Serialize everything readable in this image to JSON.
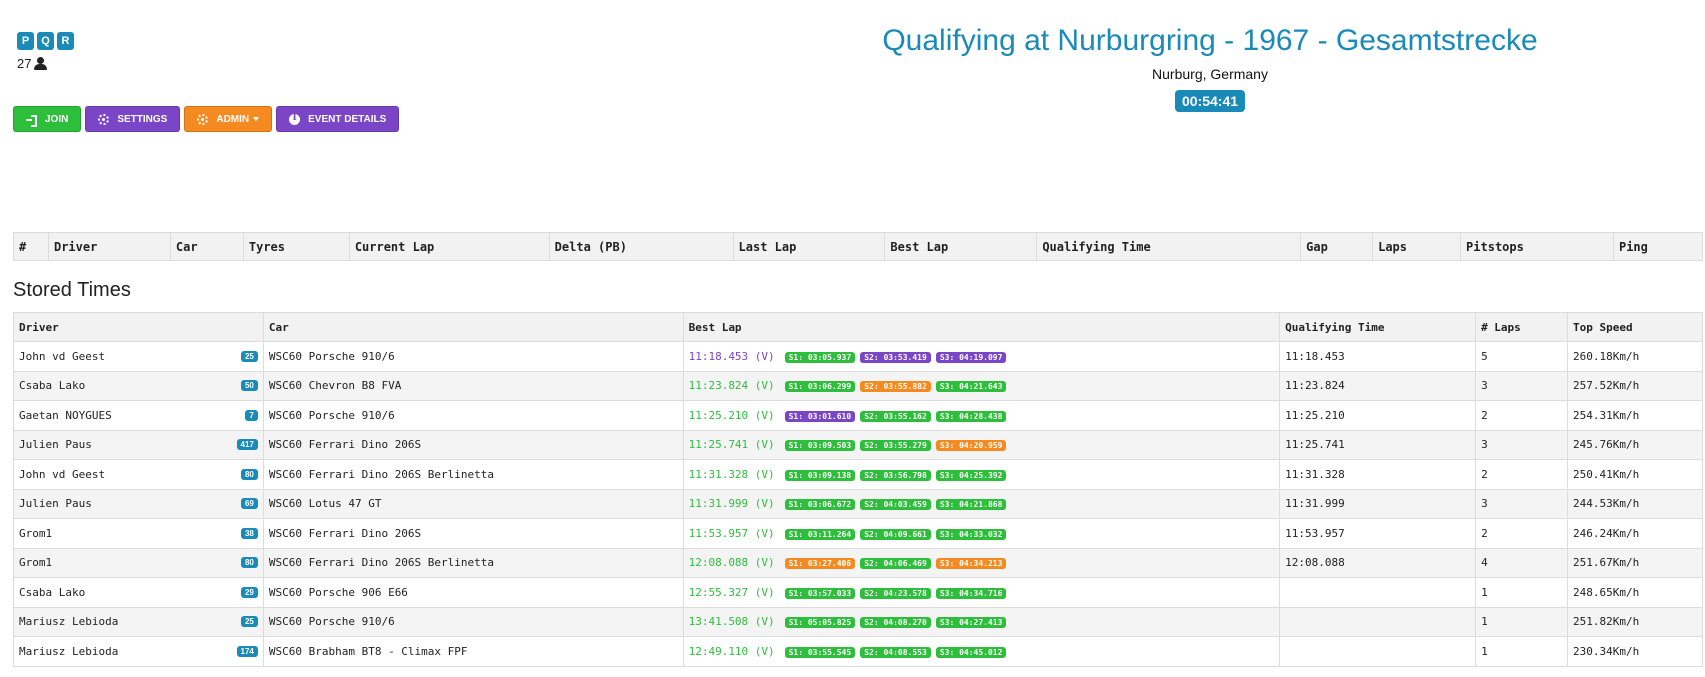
{
  "header": {
    "badges": [
      "P",
      "Q",
      "R"
    ],
    "viewer_count": "27",
    "title": "Qualifying at Nurburgring - 1967 - Gesamtstrecke",
    "location": "Nurburg, Germany",
    "timer": "00:54:41"
  },
  "buttons": {
    "join": "JOIN",
    "settings": "SETTINGS",
    "admin": "ADMIN",
    "event_details": "EVENT DETAILS"
  },
  "colors": {
    "accent": "#1a8ab8",
    "green": "#2dbe3b",
    "purple": "#7a45c6",
    "orange": "#f58a20"
  },
  "live_table": {
    "headers": [
      "#",
      "Driver",
      "Car",
      "Tyres",
      "Current Lap",
      "Delta (PB)",
      "Last Lap",
      "Best Lap",
      "Qualifying Time",
      "Gap",
      "Laps",
      "Pitstops",
      "Ping"
    ]
  },
  "stored": {
    "title": "Stored Times",
    "headers": [
      "Driver",
      "Car",
      "Best Lap",
      "Qualifying Time",
      "# Laps",
      "Top Speed"
    ],
    "rows": [
      {
        "driver": "John vd Geest",
        "num": "25",
        "car": "WSC60 Porsche 910/6",
        "best": "11:18.453 (V)",
        "best_color": "purple",
        "s1": "S1: 03:05.937",
        "s1c": "green",
        "s2": "S2: 03:53.419",
        "s2c": "purple",
        "s3": "S3: 04:19.097",
        "s3c": "purple",
        "qual": "11:18.453",
        "laps": "5",
        "speed": "260.18Km/h"
      },
      {
        "driver": "Csaba Lako",
        "num": "50",
        "car": "WSC60 Chevron B8 FVA",
        "best": "11:23.824 (V)",
        "best_color": "green",
        "s1": "S1: 03:06.299",
        "s1c": "green",
        "s2": "S2: 03:55.882",
        "s2c": "orange",
        "s3": "S3: 04:21.643",
        "s3c": "green",
        "qual": "11:23.824",
        "laps": "3",
        "speed": "257.52Km/h"
      },
      {
        "driver": "Gaetan NOYGUES",
        "num": "7",
        "car": "WSC60 Porsche 910/6",
        "best": "11:25.210 (V)",
        "best_color": "green",
        "s1": "S1: 03:01.610",
        "s1c": "purple",
        "s2": "S2: 03:55.162",
        "s2c": "green",
        "s3": "S3: 04:28.438",
        "s3c": "green",
        "qual": "11:25.210",
        "laps": "2",
        "speed": "254.31Km/h"
      },
      {
        "driver": "Julien Paus",
        "num": "417",
        "car": "WSC60 Ferrari Dino 206S",
        "best": "11:25.741 (V)",
        "best_color": "green",
        "s1": "S1: 03:09.503",
        "s1c": "green",
        "s2": "S2: 03:55.279",
        "s2c": "green",
        "s3": "S3: 04:20.959",
        "s3c": "orange",
        "qual": "11:25.741",
        "laps": "3",
        "speed": "245.76Km/h"
      },
      {
        "driver": "John vd Geest",
        "num": "80",
        "car": "WSC60 Ferrari Dino 206S Berlinetta",
        "best": "11:31.328 (V)",
        "best_color": "green",
        "s1": "S1: 03:09.138",
        "s1c": "green",
        "s2": "S2: 03:56.798",
        "s2c": "green",
        "s3": "S3: 04:25.392",
        "s3c": "green",
        "qual": "11:31.328",
        "laps": "2",
        "speed": "250.41Km/h"
      },
      {
        "driver": "Julien Paus",
        "num": "69",
        "car": "WSC60 Lotus 47 GT",
        "best": "11:31.999 (V)",
        "best_color": "green",
        "s1": "S1: 03:06.672",
        "s1c": "green",
        "s2": "S2: 04:03.459",
        "s2c": "green",
        "s3": "S3: 04:21.868",
        "s3c": "green",
        "qual": "11:31.999",
        "laps": "3",
        "speed": "244.53Km/h"
      },
      {
        "driver": "Grom1",
        "num": "38",
        "car": "WSC60 Ferrari Dino 206S",
        "best": "11:53.957 (V)",
        "best_color": "green",
        "s1": "S1: 03:11.264",
        "s1c": "green",
        "s2": "S2: 04:09.661",
        "s2c": "green",
        "s3": "S3: 04:33.032",
        "s3c": "green",
        "qual": "11:53.957",
        "laps": "2",
        "speed": "246.24Km/h"
      },
      {
        "driver": "Grom1",
        "num": "80",
        "car": "WSC60 Ferrari Dino 206S Berlinetta",
        "best": "12:08.088 (V)",
        "best_color": "green",
        "s1": "S1: 03:27.406",
        "s1c": "orange",
        "s2": "S2: 04:06.469",
        "s2c": "green",
        "s3": "S3: 04:34.213",
        "s3c": "orange",
        "qual": "12:08.088",
        "laps": "4",
        "speed": "251.67Km/h"
      },
      {
        "driver": "Csaba Lako",
        "num": "29",
        "car": "WSC60 Porsche 906 E66",
        "best": "12:55.327 (V)",
        "best_color": "green",
        "s1": "S1: 03:57.033",
        "s1c": "green",
        "s2": "S2: 04:23.578",
        "s2c": "green",
        "s3": "S3: 04:34.716",
        "s3c": "green",
        "qual": "",
        "laps": "1",
        "speed": "248.65Km/h"
      },
      {
        "driver": "Mariusz Lebioda",
        "num": "25",
        "car": "WSC60 Porsche 910/6",
        "best": "13:41.508 (V)",
        "best_color": "green",
        "s1": "S1: 05:05.825",
        "s1c": "green",
        "s2": "S2: 04:08.270",
        "s2c": "green",
        "s3": "S3: 04:27.413",
        "s3c": "green",
        "qual": "",
        "laps": "1",
        "speed": "251.82Km/h"
      },
      {
        "driver": "Mariusz Lebioda",
        "num": "174",
        "car": "WSC60 Brabham BT8 - Climax FPF",
        "best": "12:49.110 (V)",
        "best_color": "green",
        "s1": "S1: 03:55.545",
        "s1c": "green",
        "s2": "S2: 04:08.553",
        "s2c": "green",
        "s3": "S3: 04:45.012",
        "s3c": "green",
        "qual": "",
        "laps": "1",
        "speed": "230.34Km/h"
      }
    ]
  }
}
